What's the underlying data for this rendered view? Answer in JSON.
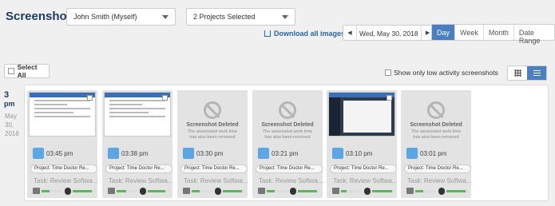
{
  "header": {
    "title": "Screenshots",
    "user_select": "John Smith (Myself)",
    "project_select": "2 Projects Selected",
    "download_label": "Download all images",
    "date": "Wed, May 30, 2018",
    "ranges": [
      "Day",
      "Week",
      "Month",
      "Date Range"
    ],
    "active_range": "Day"
  },
  "toolbar": {
    "select_all": "Select All",
    "low_activity": "Show only low activity screenshots"
  },
  "hour_block": {
    "hour": "3",
    "ampm": "pm",
    "month": "May",
    "day": "30,",
    "year": "2018"
  },
  "cards": [
    {
      "time": "03:45 pm",
      "project": "Project: Time Doctor Re...",
      "task": "Task: Review Softwa...",
      "deleted": false,
      "thumb": "doc",
      "keyboard": 0.4,
      "mouse": 0.85
    },
    {
      "time": "03:38 pm",
      "project": "Project: Time Doctor Re...",
      "task": "Task: Review Softwa...",
      "deleted": false,
      "thumb": "doc",
      "keyboard": 0.45,
      "mouse": 0.8
    },
    {
      "time": "03:30 pm",
      "project": "Project: Time Doctor Re...",
      "task": "Task: Review Softwa...",
      "deleted": true,
      "deleted_title": "Screenshot Deleted",
      "deleted_desc": "The associated work time has also been removed",
      "keyboard": 0.4,
      "mouse": 0.85
    },
    {
      "time": "03:21 pm",
      "project": "Project: Time Doctor Re...",
      "task": "Task: Review Softwa...",
      "deleted": true,
      "deleted_title": "Screenshot Deleted",
      "deleted_desc": "The associated work time has also been removed",
      "keyboard": 0.4,
      "mouse": 0.85
    },
    {
      "time": "03:10 pm",
      "project": "Project: Time Doctor Re...",
      "task": "Task: Review Softwa...",
      "deleted": false,
      "thumb": "dark",
      "keyboard": 0.25,
      "mouse": 0.9
    },
    {
      "time": "03:01 pm",
      "project": "Project: Time Doctor Re...",
      "task": "Task: Review Softwa...",
      "deleted": true,
      "deleted_title": "Screenshot Deleted",
      "deleted_desc": "The associated work time has also been removed",
      "keyboard": 0.4,
      "mouse": 0.85
    }
  ],
  "colors": {
    "accent": "#4a7fc1",
    "title": "#1d3b5e",
    "activity": "#5ab85a"
  }
}
